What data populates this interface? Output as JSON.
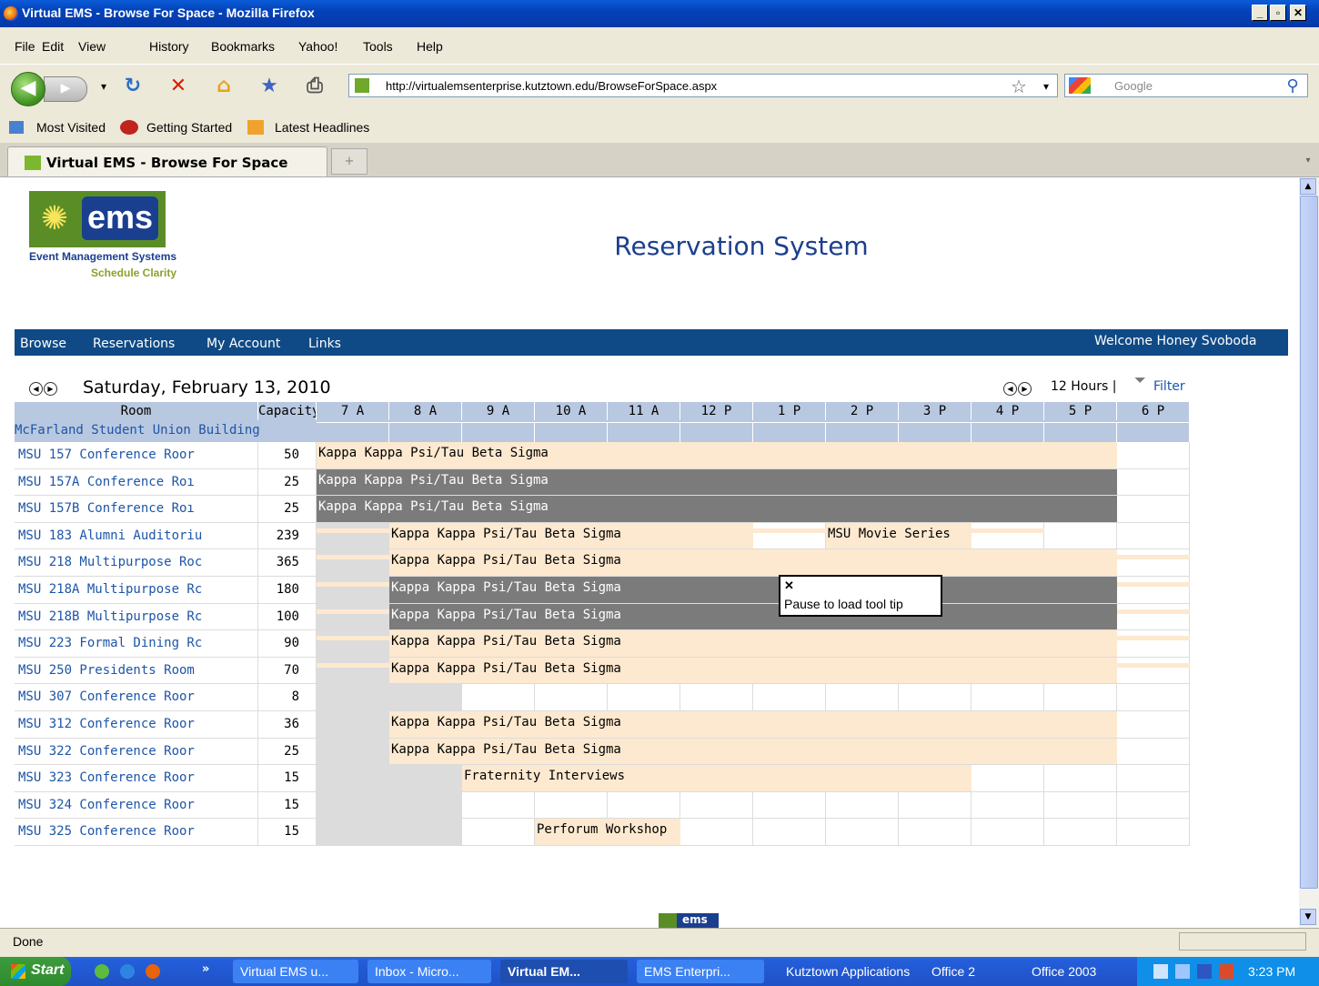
{
  "window": {
    "title": "Virtual EMS - Browse For Space - Mozilla Firefox"
  },
  "menu": [
    "File",
    "Edit",
    "View",
    "History",
    "Bookmarks",
    "Yahoo!",
    "Tools",
    "Help"
  ],
  "nav": {
    "url": "http://virtualemsenterprise.kutztown.edu/BrowseForSpace.aspx",
    "search_placeholder": "Google"
  },
  "bookmarks": [
    "Most Visited",
    "Getting Started",
    "Latest Headlines"
  ],
  "tab": {
    "label": "Virtual EMS - Browse For Space",
    "new_tab": "+"
  },
  "page": {
    "logo_word": "ems",
    "logo_line1": "Event Management Systems",
    "logo_line2": "Schedule Clarity",
    "title": "Reservation System",
    "nav": [
      "Browse",
      "Reservations",
      "My Account",
      "Links"
    ],
    "welcome": "Welcome Honey Svoboda",
    "date": "Saturday, February 13, 2010",
    "hours": "12 Hours |",
    "filter": "Filter"
  },
  "grid": {
    "col_room": "Room",
    "col_capacity": "Capacity",
    "hours": [
      "7 A",
      "8 A",
      "9 A",
      "10 A",
      "11 A",
      "12 P",
      "1 P",
      "2 P",
      "3 P",
      "4 P",
      "5 P",
      "6 P"
    ],
    "building": "McFarland Student Union Building",
    "rooms": [
      {
        "name": "MSU 157 Conference Roor",
        "capacity": "50"
      },
      {
        "name": "MSU 157A Conference Roı",
        "capacity": "25"
      },
      {
        "name": "MSU 157B Conference Roı",
        "capacity": "25"
      },
      {
        "name": "MSU 183 Alumni Auditoriu",
        "capacity": "239"
      },
      {
        "name": "MSU 218 Multipurpose Roc",
        "capacity": "365"
      },
      {
        "name": "MSU 218A Multipurpose Rс",
        "capacity": "180"
      },
      {
        "name": "MSU 218B Multipurpose Rс",
        "capacity": "100"
      },
      {
        "name": "MSU 223 Formal Dining Rc",
        "capacity": "90"
      },
      {
        "name": "MSU 250 Presidents Room",
        "capacity": "70"
      },
      {
        "name": "MSU 307 Conference Roor",
        "capacity": "8"
      },
      {
        "name": "MSU 312 Conference Roor",
        "capacity": "36"
      },
      {
        "name": "MSU 322 Conference Roor",
        "capacity": "25"
      },
      {
        "name": "MSU 323 Conference Roor",
        "capacity": "15"
      },
      {
        "name": "MSU 324 Conference Roor",
        "capacity": "15"
      },
      {
        "name": "MSU 325 Conference Roor",
        "capacity": "15"
      }
    ],
    "events": {
      "kkp": "Kappa Kappa Psi/Tau Beta Sigma",
      "movie": "MSU Movie Series",
      "frat": "Fraternity Interviews",
      "perf": "Perforum Workshop"
    }
  },
  "tooltip": {
    "text": "Pause to load tool tip"
  },
  "footer_logo": "ems",
  "status": {
    "text": "Done"
  },
  "taskbar": {
    "start": "Start",
    "tasks": [
      "Virtual EMS u...",
      "Inbox - Micro...",
      "Virtual EM...",
      "EMS Enterpri...",
      "Kutztown Applications",
      "Office 2",
      "Office 2003"
    ],
    "clock": "3:23 PM"
  }
}
